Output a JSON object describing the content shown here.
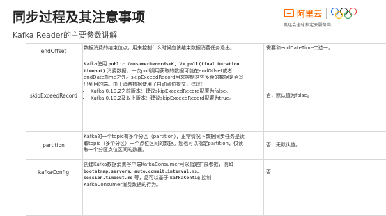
{
  "header": {
    "title": "同步过程及其注意事项",
    "subtitle": "Kafka Reader的主要参数讲解"
  },
  "brand": {
    "name": "阿里云",
    "tagline": "奥运会全球指定云服务商",
    "accent": "#ff6a00"
  },
  "table": {
    "rows": [
      {
        "name": "endOffset",
        "desc": "数据消费的结束位点，用来控制什么时候应该结束数据消费任务退出。",
        "default": "需要和endDateTime二选一。"
      },
      {
        "name": "skipExceedRecord",
        "desc_pre": "Kafka使用",
        "desc_code1": "public ConsumerRecords<K, V> poll(final Duration timeout)",
        "desc_mid": "消费数据，一次poll调用获取的数据可能在endOffset或者endDateTime之外。skipExceedRecord用来控制这些多余的数据是否写出到目的端。由于消费数据使用了自动点位提交，建议：",
        "bullets": [
          "Kafka 0.10.2之前版本：建议skipExceedRecord配置为false。",
          "Kafka 0.10.2及以上版本：建议skipExceedRecord配置为true。"
        ],
        "default": "否，默认值为false。"
      },
      {
        "name": "partition",
        "desc": "Kafka的一个topic有多个分区（partition），正常情况下数据同步任务是读取topic（多个分区）一个点位区间的数据。您也可以指定partition，仅读取一个分区点位区间的数据。",
        "default": "否，无默认值。"
      },
      {
        "name": "kafkaConfig",
        "desc_pre": "创建Kafka数据消费客户端KafkaConsumer可以指定扩展参数，例如",
        "desc_code1": "bootstrap.servers、auto.commit.interval.ms、session.timeout.ms",
        "desc_mid": "等，您可以基于",
        "desc_code2": "kafkaConfig",
        "desc_post": "控制KafkaConsumer消费数据的行为。",
        "default": "否"
      }
    ]
  }
}
